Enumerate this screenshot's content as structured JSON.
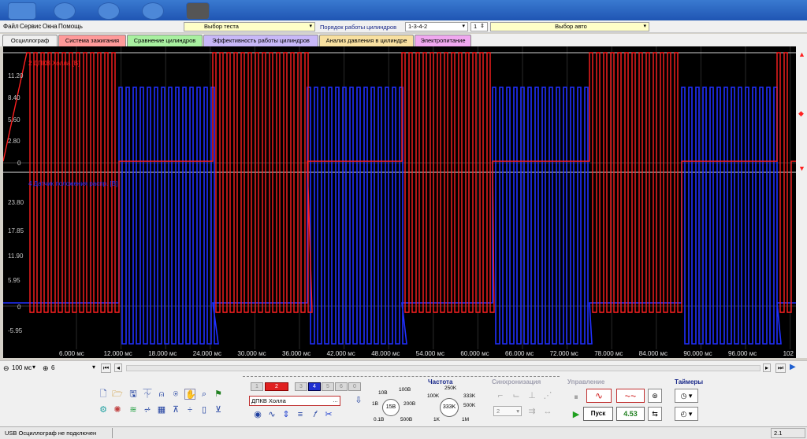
{
  "menu": [
    "Файл",
    "Сервис",
    "Окна",
    "Помощь"
  ],
  "header": {
    "test_select": "Выбор теста",
    "cyl_order_label": "Порядок работы цилиндров",
    "cyl_order_value": "1-3-4-2",
    "cyl_num": "1",
    "auto_select": "Выбор авто"
  },
  "tabs": [
    {
      "label": "Осциллограф",
      "color": "#f0f0f0"
    },
    {
      "label": "Система зажигания",
      "color": "#ff9a9a"
    },
    {
      "label": "Сравнение цилиндров",
      "color": "#a8f0a0"
    },
    {
      "label": "Эффективность работы цилиндров",
      "color": "#c8b8f8"
    },
    {
      "label": "Анализ давления в цилиндре",
      "color": "#f8e0a0"
    },
    {
      "label": "Электропитание",
      "color": "#f0a8f0"
    }
  ],
  "scope": {
    "ch1_label": "2 ДПКВ Холла [В]",
    "ch2_label": "4 Датчик положения распр. [В]",
    "y_top": [
      "11.20",
      "8.40",
      "5.60",
      "2.80",
      "0"
    ],
    "y_bottom": [
      "23.80",
      "17.85",
      "11.90",
      "5.95",
      "0",
      "-5.95"
    ],
    "x_ticks": [
      "6.000 мс",
      "12.000 мс",
      "18.000 мс",
      "24.000 мс",
      "30.000 мс",
      "36.000 мс",
      "42.000 мс",
      "48.000 мс",
      "54.000 мс",
      "60.000 мс",
      "66.000 мс",
      "72.000 мс",
      "78.000 мс",
      "84.000 мс",
      "90.000 мс",
      "96.000 мс",
      "102"
    ],
    "red_color": "#ff2020",
    "blue_color": "#2030ff",
    "bg_color": "#000000"
  },
  "hscroll": {
    "timebase": "100 мс",
    "channel": "6"
  },
  "tools": {
    "channel_buttons": [
      "1",
      "2",
      "3",
      "4",
      "5",
      "6",
      "0"
    ],
    "sensor": "ДПКВ Холла",
    "amp_labels": [
      "10В",
      "100В",
      "1В",
      "15В",
      "200В",
      "0.1В",
      "500В"
    ],
    "freq_title": "Частота",
    "freq_labels": [
      "250K",
      "100K",
      "333K",
      "333K",
      "500K",
      "1K",
      "1M"
    ],
    "sync_title": "Синхронизация",
    "sync_value": "2",
    "control_title": "Управление",
    "start_label": "Пуск",
    "value_display": "4.53",
    "timers_title": "Таймеры"
  },
  "status": {
    "text": "USB Осциллограф не подключен",
    "right": "2.1"
  }
}
